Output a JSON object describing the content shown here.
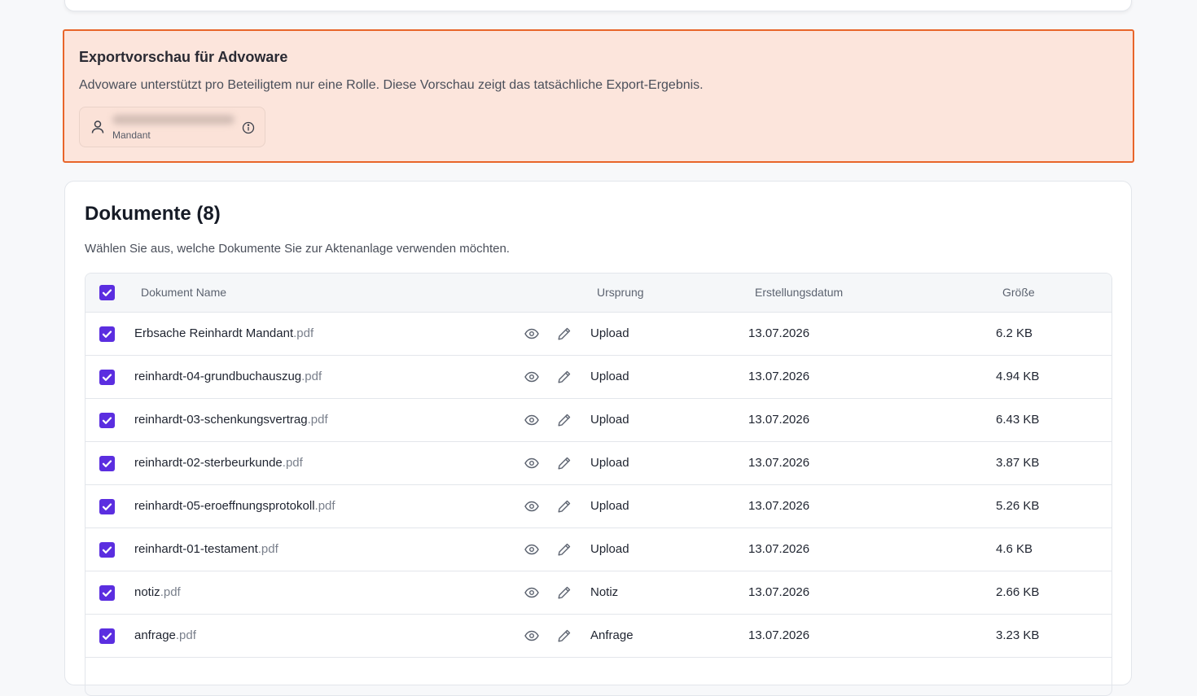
{
  "export": {
    "title": "Exportvorschau für Advoware",
    "description": "Advoware unterstützt pro Beteiligtem nur eine Rolle. Diese Vorschau zeigt das tatsächliche Export-Ergebnis.",
    "party_role": "Mandant"
  },
  "documents": {
    "title": "Dokumente (8)",
    "subtitle": "Wählen Sie aus, welche Dokumente Sie zur Aktenanlage verwenden möchten.",
    "columns": {
      "name": "Dokument Name",
      "origin": "Ursprung",
      "date": "Erstellungsdatum",
      "size": "Größe"
    },
    "rows": [
      {
        "name": "Erbsache Reinhardt Mandant",
        "ext": ".pdf",
        "origin": "Upload",
        "date": "13.07.2026",
        "size": "6.2 KB"
      },
      {
        "name": "reinhardt-04-grundbuchauszug",
        "ext": ".pdf",
        "origin": "Upload",
        "date": "13.07.2026",
        "size": "4.94 KB"
      },
      {
        "name": "reinhardt-03-schenkungsvertrag",
        "ext": ".pdf",
        "origin": "Upload",
        "date": "13.07.2026",
        "size": "6.43 KB"
      },
      {
        "name": "reinhardt-02-sterbeurkunde",
        "ext": ".pdf",
        "origin": "Upload",
        "date": "13.07.2026",
        "size": "3.87 KB"
      },
      {
        "name": "reinhardt-05-eroeffnungsprotokoll",
        "ext": ".pdf",
        "origin": "Upload",
        "date": "13.07.2026",
        "size": "5.26 KB"
      },
      {
        "name": "reinhardt-01-testament",
        "ext": ".pdf",
        "origin": "Upload",
        "date": "13.07.2026",
        "size": "4.6 KB"
      },
      {
        "name": "notiz",
        "ext": ".pdf",
        "origin": "Notiz",
        "date": "13.07.2026",
        "size": "2.66 KB"
      },
      {
        "name": "anfrage",
        "ext": ".pdf",
        "origin": "Anfrage",
        "date": "13.07.2026",
        "size": "3.23 KB"
      }
    ]
  },
  "colors": {
    "accent": "#5b2ee0",
    "export_border": "#e8652a",
    "export_bg": "#fce5dc"
  },
  "icons": [
    "user-icon",
    "info-icon",
    "eye-icon",
    "pencil-icon",
    "check-icon"
  ]
}
